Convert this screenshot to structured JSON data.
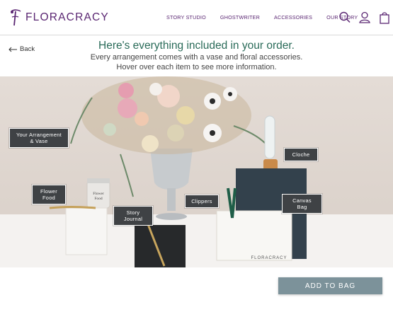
{
  "brand": {
    "name": "FLORACRACY"
  },
  "nav": {
    "items": [
      "STORY STUDIO",
      "GHOSTWRITER",
      "ACCESSORIES",
      "OUR STORY"
    ]
  },
  "header_icons": [
    "search-icon",
    "account-icon",
    "bag-icon"
  ],
  "intro": {
    "back_label": "Back",
    "headline": "Here's everything included in your order.",
    "subline1": "Every arrangement comes with a vase and floral accessories.",
    "subline2": "Hover over each item to see more information."
  },
  "hotspots": {
    "arrangement_line1": "Your Arrangement",
    "arrangement_line2": "& Vase",
    "cloche": "Cloche",
    "flower_food_line1": "Flower",
    "flower_food_line2": "Food",
    "clippers": "Clippers",
    "canvas_bag": "Canvas Bag",
    "story_journal_line1": "Story",
    "story_journal_line2": "Journal"
  },
  "product_prints": {
    "jar_label_line1": "Flower",
    "jar_label_line2": "Food",
    "bag_brand": "FLORACRACY"
  },
  "cta": {
    "add_to_bag": "ADD TO BAG"
  },
  "colors": {
    "brand_purple": "#5a2672",
    "headline_green": "#2a6b59",
    "tag_bg": "#3f4245",
    "button_bg": "#7c929a"
  }
}
